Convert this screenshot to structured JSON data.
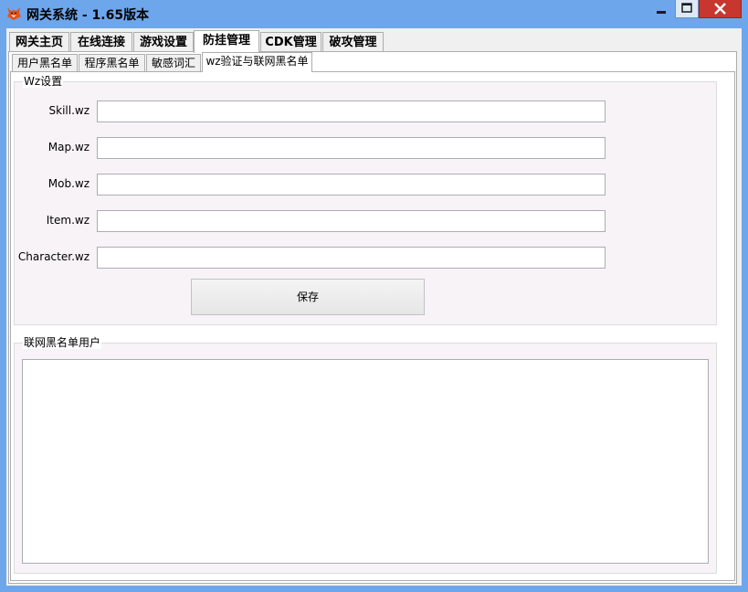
{
  "window": {
    "title": "网关系统 - 1.65版本",
    "accent_color": "#6ea6ec",
    "icon": "fox-icon"
  },
  "main_tabs": [
    {
      "label": "网关主页",
      "active": false
    },
    {
      "label": "在线连接",
      "active": false
    },
    {
      "label": "游戏设置",
      "active": false
    },
    {
      "label": "防挂管理",
      "active": true
    },
    {
      "label": "CDK管理",
      "active": false
    },
    {
      "label": "破攻管理",
      "active": false
    }
  ],
  "sub_tabs": [
    {
      "label": "用户黑名单",
      "active": false
    },
    {
      "label": "程序黑名单",
      "active": false
    },
    {
      "label": "敏感词汇",
      "active": false
    },
    {
      "label": "wz验证与联网黑名单",
      "active": true
    }
  ],
  "wz_group": {
    "legend": "Wz设置",
    "fields": [
      {
        "label": "Skill.wz",
        "value": ""
      },
      {
        "label": "Map.wz",
        "value": ""
      },
      {
        "label": "Mob.wz",
        "value": ""
      },
      {
        "label": "Item.wz",
        "value": ""
      },
      {
        "label": "Character.wz",
        "value": ""
      }
    ],
    "save_label": "保存"
  },
  "blacklist_group": {
    "legend": "联网黑名单用户",
    "items": []
  }
}
